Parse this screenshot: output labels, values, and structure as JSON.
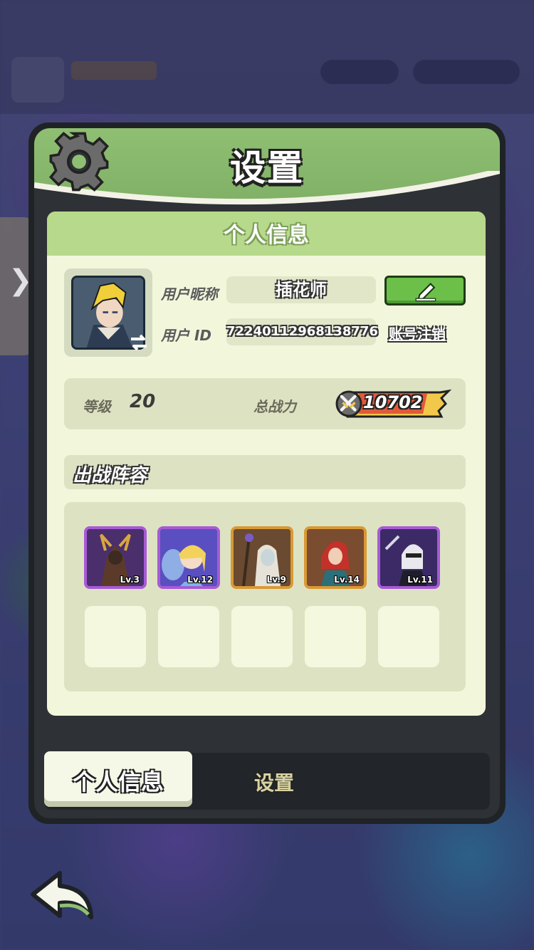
{
  "dialog": {
    "title": "设置"
  },
  "profile": {
    "section_title": "个人信息",
    "nickname_label": "用户昵称",
    "nickname": "插花师",
    "id_label": "用户 ID",
    "user_id": "72240112968138776",
    "logout_label": "账号注销",
    "level_label": "等级",
    "level": "20",
    "power_label": "总战力",
    "power": "10702"
  },
  "lineup": {
    "title": "出战阵容",
    "heroes": [
      {
        "level": "Lv.3",
        "frame": "purple"
      },
      {
        "level": "Lv.12",
        "frame": "purple"
      },
      {
        "level": "Lv.9",
        "frame": "orange"
      },
      {
        "level": "Lv.14",
        "frame": "orange"
      },
      {
        "level": "Lv.11",
        "frame": "purple"
      }
    ],
    "empty_slots": 5
  },
  "tabs": [
    {
      "label": "个人信息",
      "active": true
    },
    {
      "label": "设置",
      "active": false
    }
  ],
  "icons": {
    "settings": "gear-icon",
    "edit": "pencil-edit-icon",
    "swap": "swap-arrows-icon",
    "power": "crossed-swords-icon",
    "back": "back-arrow-icon",
    "side": "chevron-right-icon"
  },
  "colors": {
    "header_green": "#8fbf73",
    "card_bg": "#f2f7dc",
    "edit_green": "#6cc04a",
    "power_yellow": "#f2c84b"
  }
}
